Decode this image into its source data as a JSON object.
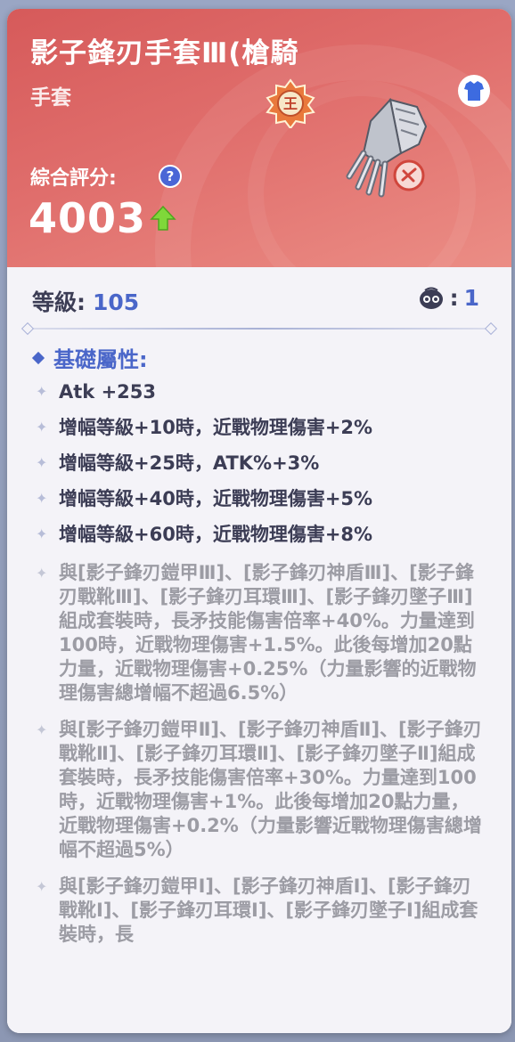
{
  "item": {
    "title": "影子鋒刃手套Ⅲ(槍騎",
    "category": "手套",
    "score_label": "綜合評分:",
    "score": "4003",
    "help_glyph": "?",
    "level_label": "等級:",
    "level": "105",
    "refine_sep": ":",
    "refine_value": "1"
  },
  "section_title": "基礎屬性:",
  "attributes": [
    "Atk +253",
    "增幅等級+10時，近戰物理傷害+2%",
    "增幅等級+25時，ATK%+3%",
    "增幅等級+40時，近戰物理傷害+5%",
    "增幅等級+60時，近戰物理傷害+8%"
  ],
  "set_bonuses": [
    "與[影子鋒刃鎧甲Ⅲ]、[影子鋒刃神盾Ⅲ]、[影子鋒刃戰靴Ⅲ]、[影子鋒刃耳環Ⅲ]、[影子鋒刃墜子Ⅲ]組成套裝時，長矛技能傷害倍率+40%。力量達到100時，近戰物理傷害+1.5%。此後每增加20點力量，近戰物理傷害+0.25%（力量影響的近戰物理傷害總增幅不超過6.5%）",
    "與[影子鋒刃鎧甲Ⅱ]、[影子鋒刃神盾Ⅱ]、[影子鋒刃戰靴Ⅱ]、[影子鋒刃耳環Ⅱ]、[影子鋒刃墜子Ⅱ]組成套裝時，長矛技能傷害倍率+30%。力量達到100時，近戰物理傷害+1%。此後每增加20點力量，近戰物理傷害+0.2%（力量影響近戰物理傷害總增幅不超過5%）",
    "與[影子鋒刃鎧甲Ⅰ]、[影子鋒刃神盾Ⅰ]、[影子鋒刃戰靴Ⅰ]、[影子鋒刃耳環Ⅰ]、[影子鋒刃墜子Ⅰ]組成套裝時，長"
  ],
  "badge_glyph": "王",
  "colors": {
    "header_top": "#d65a5a",
    "accent_blue": "#4a66c9",
    "score_up": "#7fd83a",
    "body_bg": "#f4f3f8"
  }
}
